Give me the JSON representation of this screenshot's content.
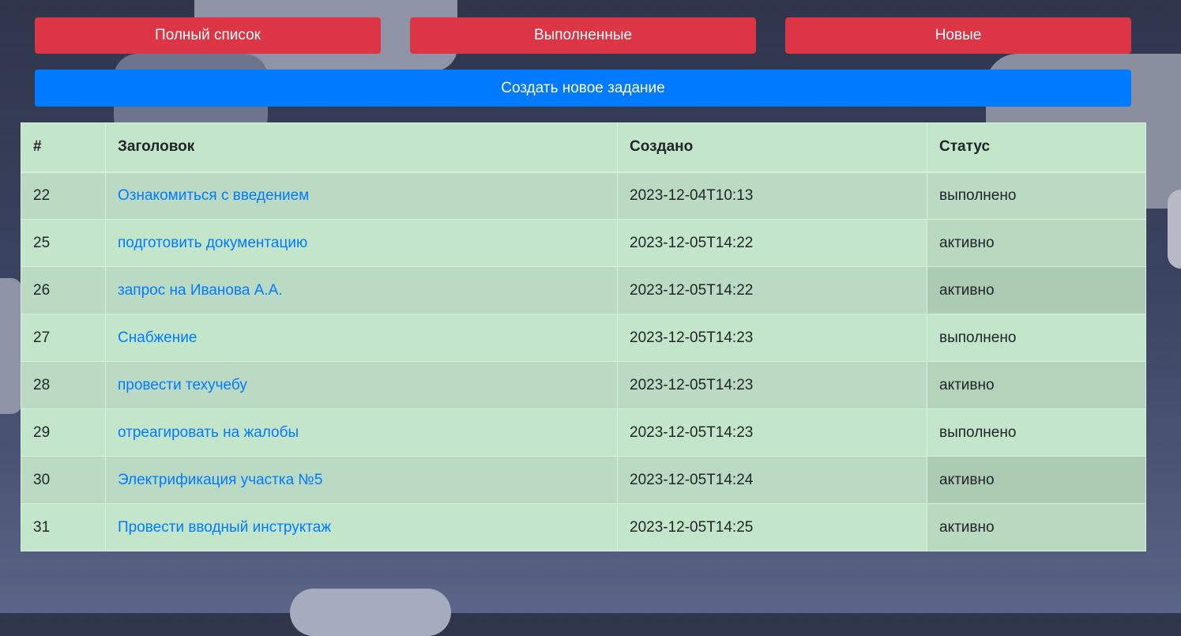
{
  "nav": {
    "full_list": "Полный список",
    "completed": "Выполненные",
    "new": "Новые",
    "create": "Создать новое задание"
  },
  "table": {
    "headers": {
      "num": "#",
      "title": "Заголовок",
      "created": "Создано",
      "status": "Статус"
    },
    "rows": [
      {
        "id": "22",
        "title": "Ознакомиться с введением",
        "created": "2023-12-04T10:13",
        "status": "выполнено"
      },
      {
        "id": "25",
        "title": "подготовить документацию",
        "created": "2023-12-05T14:22",
        "status": "активно"
      },
      {
        "id": "26",
        "title": "запрос на Иванова А.А.",
        "created": "2023-12-05T14:22",
        "status": "активно"
      },
      {
        "id": "27",
        "title": "Снабжение",
        "created": "2023-12-05T14:23",
        "status": "выполнено"
      },
      {
        "id": "28",
        "title": "провести техучебу",
        "created": "2023-12-05T14:23",
        "status": "активно"
      },
      {
        "id": "29",
        "title": "отреагировать на жалобы",
        "created": "2023-12-05T14:23",
        "status": "выполнено"
      },
      {
        "id": "30",
        "title": "Электрификация участка №5",
        "created": "2023-12-05T14:24",
        "status": "активно"
      },
      {
        "id": "31",
        "title": "Провести вводный инструктаж",
        "created": "2023-12-05T14:25",
        "status": "активно"
      }
    ]
  },
  "colors": {
    "danger": "#dc3545",
    "primary": "#007bff",
    "table_success": "#c3e6cb",
    "link": "#007bff"
  }
}
